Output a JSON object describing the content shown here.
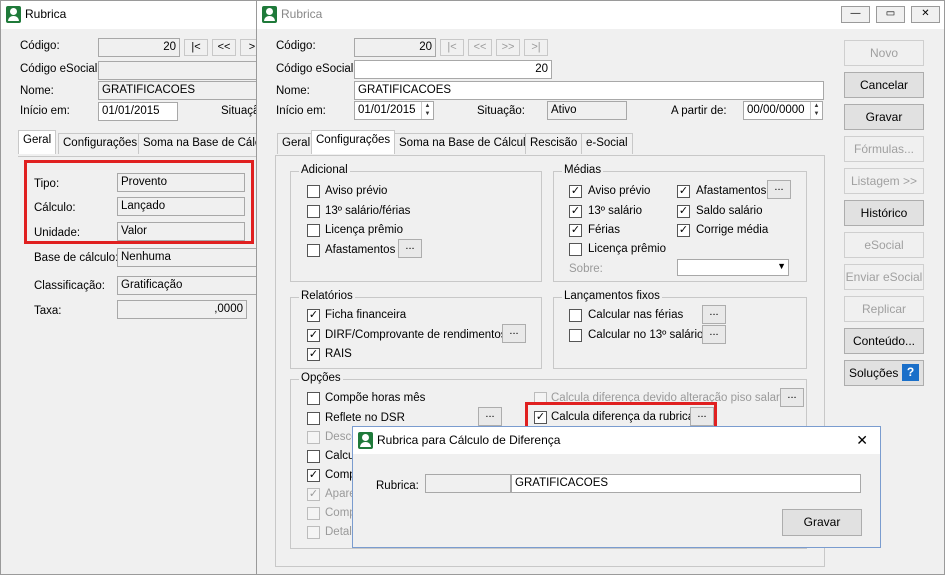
{
  "back_window": {
    "title": "Rubrica",
    "codigo_label": "Código:",
    "codigo_value": "20",
    "codigo_esocial_label": "Código eSocial:",
    "nome_label": "Nome:",
    "nome_value": "GRATIFICACOES",
    "inicio_label": "Início em:",
    "inicio_value": "01/01/2015",
    "situacao_label": "Situaçã",
    "tabs": [
      "Geral",
      "Configurações",
      "Soma na Base de Cálculo"
    ],
    "tipo_label": "Tipo:",
    "tipo_value": "Provento",
    "calculo_label": "Cálculo:",
    "calculo_value": "Lançado",
    "unidade_label": "Unidade:",
    "unidade_value": "Valor",
    "base_label": "Base de cálculo:",
    "base_value": "Nenhuma",
    "classificacao_label": "Classificação:",
    "classificacao_value": "Gratificação",
    "taxa_label": "Taxa:",
    "taxa_value": ",0000"
  },
  "main_window": {
    "title": "Rubrica",
    "codigo_label": "Código:",
    "codigo_value": "20",
    "nav_first": "|<",
    "nav_prev": "<<",
    "nav_next": ">>",
    "nav_last": ">|",
    "codigo_esocial_label": "Código eSocial:",
    "codigo_esocial_value": "20",
    "nome_label": "Nome:",
    "nome_value": "GRATIFICACOES",
    "inicio_label": "Início em:",
    "inicio_value": "01/01/2015",
    "situacao_label": "Situação:",
    "situacao_value": "Ativo",
    "a_partir_label": "A partir de:",
    "a_partir_value": "00/00/0000",
    "tabs": [
      "Geral",
      "Configurações",
      "Soma na Base de Cálculo",
      "Rescisão",
      "e-Social"
    ],
    "adicional": {
      "title": "Adicional",
      "items": [
        "Aviso prévio",
        "13º salário/férias",
        "Licença prêmio",
        "Afastamentos"
      ],
      "dots": "..."
    },
    "medias": {
      "title": "Médias",
      "items": [
        "Aviso prévio",
        "13º salário",
        "Férias",
        "Licença prêmio"
      ],
      "items_right": [
        "Afastamentos",
        "Saldo salário",
        "Corrige média"
      ],
      "sobre_label": "Sobre:"
    },
    "relatorios": {
      "title": "Relatórios",
      "items": [
        "Ficha financeira",
        "DIRF/Comprovante de rendimentos",
        "RAIS"
      ]
    },
    "lancamentos": {
      "title": "Lançamentos fixos",
      "items": [
        "Calcular nas férias",
        "Calcular no 13º salário"
      ]
    },
    "opcoes": {
      "title": "Opções",
      "items": [
        "Compõe horas mês",
        "Reflete no DSR",
        "Desco",
        "Calcul",
        "Comp",
        "Apare",
        "Compó",
        "Detalh"
      ],
      "right_items": [
        "Calcula diferença devido alteração piso salarial",
        "Calcula diferença da rubrica"
      ]
    },
    "buttons": [
      "Novo",
      "Cancelar",
      "Gravar",
      "Fórmulas...",
      "Listagem >>",
      "Histórico",
      "eSocial",
      "Enviar eSocial",
      "Replicar",
      "Conteúdo...",
      "Soluções"
    ]
  },
  "dialog": {
    "title": "Rubrica para Cálculo de Diferença",
    "rubrica_label": "Rubrica:",
    "rubrica_value": "GRATIFICACOES",
    "gravar": "Gravar",
    "close": "✕"
  },
  "colors": {
    "highlight_red": "#e02020",
    "app_icon_green": "#1f7a3a",
    "help_blue": "#1a6fc9"
  }
}
